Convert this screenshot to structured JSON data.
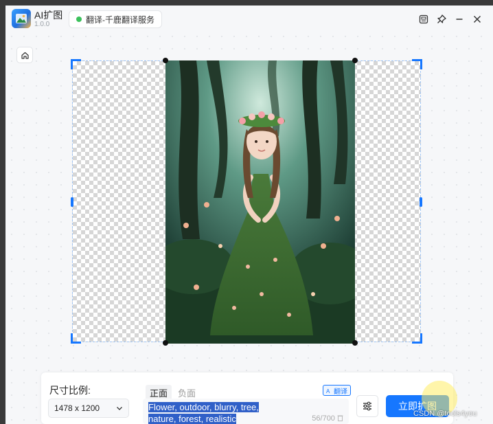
{
  "app": {
    "name": "AI扩图",
    "version": "1.0.0",
    "service_label": "翻译-千鹿翻译服务",
    "service_status_color": "#3bc15b"
  },
  "window_controls": [
    "screenshot-icon",
    "pin-icon",
    "minimize-icon",
    "close-icon"
  ],
  "canvas": {
    "image_description_icon": "forest-girl-photo",
    "accent_color": "#1677ff"
  },
  "panel": {
    "ratio_label": "尺寸比例:",
    "ratio_value": "1478 x 1200",
    "tab_positive": "正面",
    "tab_negative": "负面",
    "translate_label": "翻译",
    "prompt_line1": "Flower, outdoor, blurry, tree,",
    "prompt_line2": "nature, forest, realistic",
    "char_count": "56/700",
    "expand_button": "立即扩图"
  },
  "watermark": "CSDN @tools4you"
}
